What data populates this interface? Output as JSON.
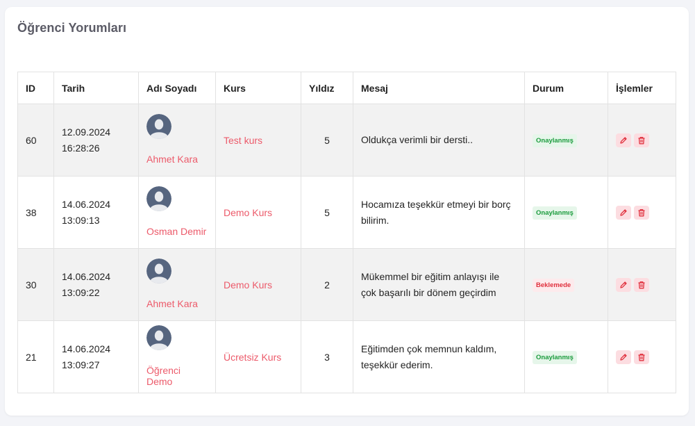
{
  "page": {
    "title": "Öğrenci Yorumları"
  },
  "table": {
    "headers": {
      "id": "ID",
      "date": "Tarih",
      "name": "Adı Soyadı",
      "course": "Kurs",
      "stars": "Yıldız",
      "message": "Mesaj",
      "status": "Durum",
      "actions": "İşlemler"
    },
    "rows": [
      {
        "id": "60",
        "date": "12.09.2024",
        "time": "16:28:26",
        "name": "Ahmet Kara",
        "course": "Test kurs",
        "stars": "5",
        "message": "Oldukça verimli bir dersti..",
        "status": "Onaylanmış",
        "status_type": "approved"
      },
      {
        "id": "38",
        "date": "14.06.2024",
        "time": "13:09:13",
        "name": "Osman Demir",
        "course": "Demo Kurs",
        "stars": "5",
        "message": "Hocamıza teşekkür etmeyi bir borç bilirim.",
        "status": "Onaylanmış",
        "status_type": "approved"
      },
      {
        "id": "30",
        "date": "14.06.2024",
        "time": "13:09:22",
        "name": "Ahmet Kara",
        "course": "Demo Kurs",
        "stars": "2",
        "message": "Mükemmel bir eğitim anlayışı ile çok başarılı bir dönem geçirdim",
        "status": "Beklemede",
        "status_type": "pending"
      },
      {
        "id": "21",
        "date": "14.06.2024",
        "time": "13:09:27",
        "name": "Öğrenci Demo",
        "course": "Ücretsiz Kurs",
        "stars": "3",
        "message": "Eğitimden çok memnun kaldım, teşekkür ederim.",
        "status": "Onaylanmış",
        "status_type": "approved"
      }
    ]
  },
  "colors": {
    "link": "#ec5a6a",
    "approved_bg": "#e6f6ea",
    "approved_text": "#1a9b3c",
    "pending_bg": "#fdeaec",
    "pending_text": "#e0303d",
    "action_bg": "#fcdde1",
    "action_icon": "#e0303d",
    "avatar": "#56657f"
  },
  "icons": {
    "avatar": "user-avatar-icon",
    "edit": "pencil-icon",
    "delete": "trash-icon"
  }
}
